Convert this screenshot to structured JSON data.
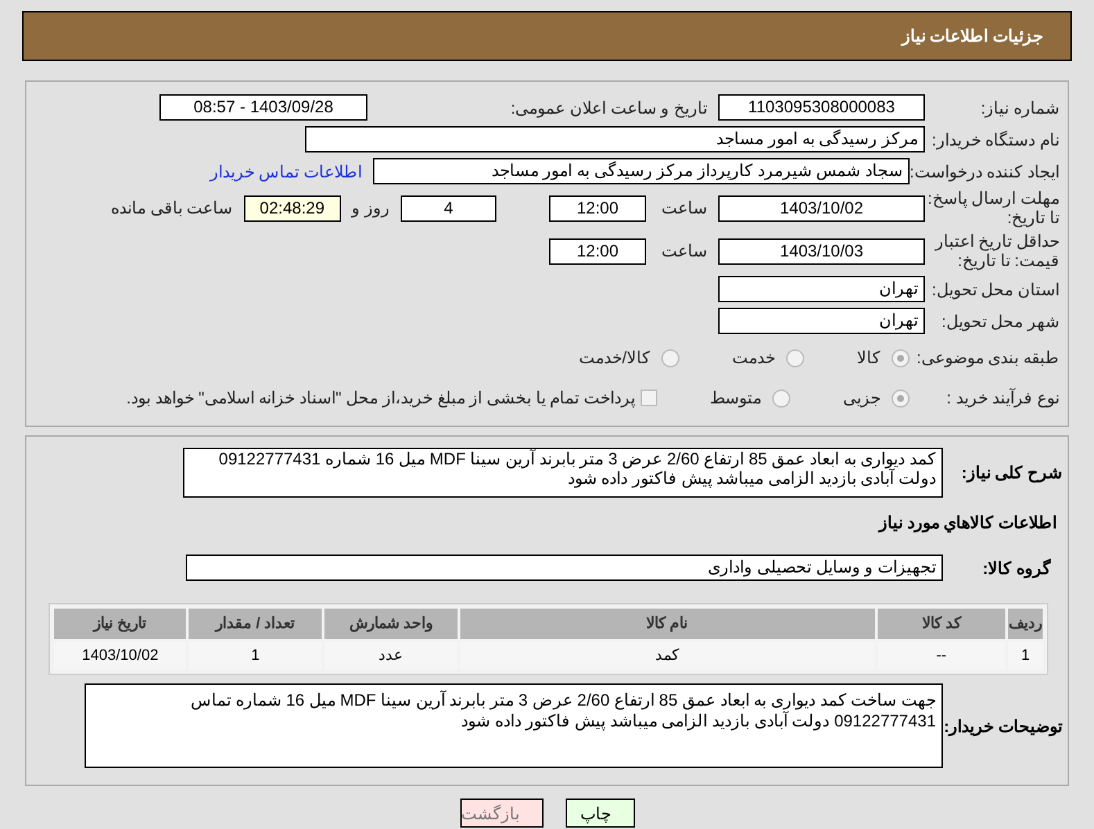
{
  "header": {
    "title": "جزئیات اطلاعات نیاز"
  },
  "need_number": {
    "label": "شماره نیاز:",
    "value": "1103095308000083"
  },
  "announce": {
    "label": "تاریخ و ساعت اعلان عمومی:",
    "value": "1403/09/28 - 08:57"
  },
  "buyer_org": {
    "label": "نام دستگاه خریدار:",
    "value": "مرکز رسیدگی به امور مساجد"
  },
  "requester": {
    "label": "ایجاد کننده درخواست:",
    "value": "سجاد شمس شیرمرد کارپرداز مرکز رسیدگی به امور مساجد",
    "link": "اطلاعات تماس خریدار"
  },
  "deadline": {
    "label": "مهلت ارسال پاسخ: تا تاریخ:",
    "date": "1403/10/02",
    "time_label": "ساعت",
    "time": "12:00",
    "days": "4",
    "days_label": "روز و",
    "remaining": "02:48:29",
    "remaining_label": "ساعت باقی مانده"
  },
  "price_validity": {
    "label": "حداقل تاریخ اعتبار قیمت: تا تاریخ:",
    "date": "1403/10/03",
    "time_label": "ساعت",
    "time": "12:00"
  },
  "province": {
    "label": "استان محل تحویل:",
    "value": "تهران"
  },
  "city": {
    "label": "شهر محل تحویل:",
    "value": "تهران"
  },
  "category": {
    "label": "طبقه بندی موضوعی:",
    "options": [
      {
        "label": "کالا",
        "selected": true
      },
      {
        "label": "خدمت",
        "selected": false
      },
      {
        "label": "کالا/خدمت",
        "selected": false
      }
    ]
  },
  "purchase_type": {
    "label": "نوع فرآیند خرید :",
    "options": [
      {
        "label": "جزیی",
        "selected": true
      },
      {
        "label": "متوسط",
        "selected": false
      }
    ],
    "treasury": {
      "label": "پرداخت تمام یا بخشی از مبلغ خرید،از محل \"اسناد خزانه اسلامی\" خواهد بود.",
      "checked": false
    }
  },
  "summary": {
    "label": "شرح کلی نیاز:",
    "value": "کمد دیواری به ابعاد عمق 85 ارتفاع 2/60 عرض 3 متر بابرند آرین سینا MDF   میل 16 شماره 09122777431 دولت آبادی بازدید الزامی میباشد پیش فاکتور داده شود"
  },
  "goods_title": "اطلاعات کالاهاي مورد نياز",
  "goods_group": {
    "label": "گروه کالا:",
    "value": "تجهیزات و وسایل تحصیلی واداری"
  },
  "table": {
    "columns": [
      "ردیف",
      "کد کالا",
      "نام کالا",
      "واحد شمارش",
      "تعداد / مقدار",
      "تاریخ نیاز"
    ],
    "rows": [
      [
        "1",
        "--",
        "کمد",
        "عدد",
        "1",
        "1403/10/02"
      ]
    ]
  },
  "buyer_notes": {
    "label": "توضیحات خریدار:",
    "value": "جهت ساخت کمد دیواری به ابعاد عمق 85 ارتفاع 2/60 عرض 3 متر بابرند آرین سینا MDF   میل 16 شماره تماس 09122777431 دولت آبادی بازدید الزامی میباشد پیش فاکتور داده شود"
  },
  "buttons": [
    {
      "label": "چاپ",
      "kind": "print"
    },
    {
      "label": "بازگشت",
      "kind": "back"
    }
  ]
}
